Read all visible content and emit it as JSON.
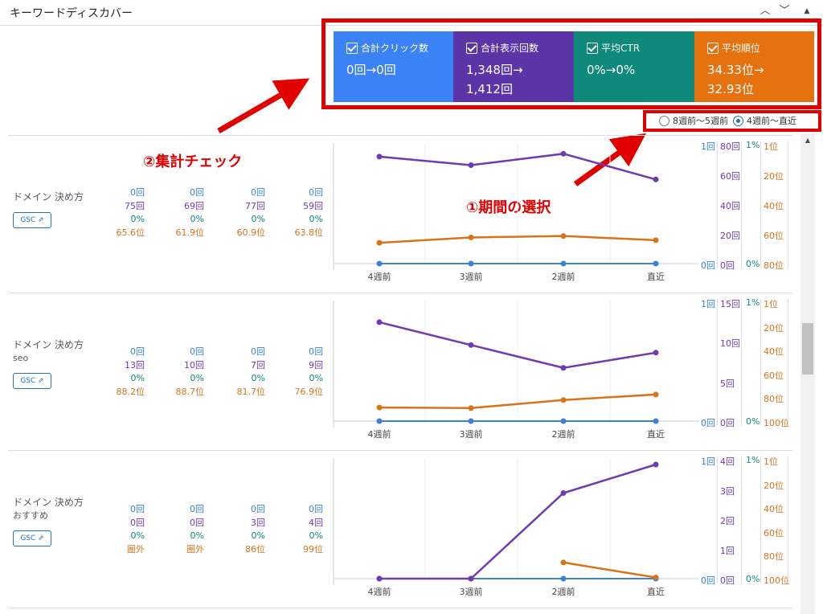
{
  "header": {
    "title": "キーワードディスカバー"
  },
  "metrics": [
    {
      "label": "合計クリック数",
      "value_line1": "0回→0回",
      "value_line2": "",
      "color": "#3b82f6"
    },
    {
      "label": "合計表示回数",
      "value_line1": "1,348回→",
      "value_line2": "1,412回",
      "color": "#5b35a8"
    },
    {
      "label": "平均CTR",
      "value_line1": "0%→0%",
      "value_line2": "",
      "color": "#0f8a7a"
    },
    {
      "label": "平均順位",
      "value_line1": "34.33位→",
      "value_line2": "32.93位",
      "color": "#e5720e"
    }
  ],
  "period": {
    "option1": "8週前〜5週前",
    "option2": "4週前〜直近",
    "selected": "option2"
  },
  "annotations": {
    "a1": "①期間の選択",
    "a2": "②集計チェック"
  },
  "gsc_label": "GSC",
  "x_labels": [
    "4週前",
    "3週前",
    "2週前",
    "直近"
  ],
  "rows": [
    {
      "keyword_line1": "ドメイン 決め方",
      "keyword_line2": "",
      "weeks": [
        {
          "clicks": "0回",
          "impressions": "75回",
          "ctr": "0%",
          "position": "65.6位"
        },
        {
          "clicks": "0回",
          "impressions": "69回",
          "ctr": "0%",
          "position": "61.9位"
        },
        {
          "clicks": "0回",
          "impressions": "77回",
          "ctr": "0%",
          "position": "60.9位"
        },
        {
          "clicks": "0回",
          "impressions": "59回",
          "ctr": "0%",
          "position": "63.8位"
        }
      ],
      "axis_clicks": [
        "1回",
        "0回"
      ],
      "axis_impr": [
        "80回",
        "60回",
        "40回",
        "20回",
        "0回"
      ],
      "axis_ctr": [
        "1%",
        "0%"
      ],
      "axis_pos": [
        "1位",
        "20位",
        "40位",
        "60位",
        "80位"
      ],
      "impr_values": [
        75,
        69,
        77,
        59
      ],
      "impr_max": 80,
      "pos_values": [
        65.6,
        61.9,
        60.9,
        63.8
      ],
      "pos_min": 1,
      "pos_max": 80
    },
    {
      "keyword_line1": "ドメイン 決め方",
      "keyword_line2": "seo",
      "weeks": [
        {
          "clicks": "0回",
          "impressions": "13回",
          "ctr": "0%",
          "position": "88.2位"
        },
        {
          "clicks": "0回",
          "impressions": "10回",
          "ctr": "0%",
          "position": "88.7位"
        },
        {
          "clicks": "0回",
          "impressions": "7回",
          "ctr": "0%",
          "position": "81.7位"
        },
        {
          "clicks": "0回",
          "impressions": "9回",
          "ctr": "0%",
          "position": "76.9位"
        }
      ],
      "axis_clicks": [
        "1回",
        "0回"
      ],
      "axis_impr": [
        "15回",
        "10回",
        "5回",
        "0回"
      ],
      "axis_ctr": [
        "1%",
        "0%"
      ],
      "axis_pos": [
        "1位",
        "20位",
        "40位",
        "60位",
        "80位",
        "100位"
      ],
      "impr_values": [
        13,
        10,
        7,
        9
      ],
      "impr_max": 15,
      "pos_values": [
        88.2,
        88.7,
        81.7,
        76.9
      ],
      "pos_min": 1,
      "pos_max": 100
    },
    {
      "keyword_line1": "ドメイン 決め方",
      "keyword_line2": "おすすめ",
      "weeks": [
        {
          "clicks": "0回",
          "impressions": "0回",
          "ctr": "0%",
          "position": "圏外"
        },
        {
          "clicks": "0回",
          "impressions": "0回",
          "ctr": "0%",
          "position": "圏外"
        },
        {
          "clicks": "0回",
          "impressions": "3回",
          "ctr": "0%",
          "position": "86位"
        },
        {
          "clicks": "0回",
          "impressions": "4回",
          "ctr": "0%",
          "position": "99位"
        }
      ],
      "axis_clicks": [
        "1回",
        "0回"
      ],
      "axis_impr": [
        "4回",
        "3回",
        "2回",
        "1回",
        "0回"
      ],
      "axis_ctr": [
        "1%",
        "0%"
      ],
      "axis_pos": [
        "1位",
        "20位",
        "40位",
        "60位",
        "80位",
        "100位"
      ],
      "impr_values": [
        0,
        0,
        3,
        4
      ],
      "impr_max": 4,
      "pos_values": [
        null,
        null,
        86,
        99
      ],
      "pos_min": 1,
      "pos_max": 100
    }
  ],
  "colors": {
    "clicks": "#3b82d6",
    "impressions": "#6f3bb3",
    "ctr": "#0f8a7a",
    "position": "#d9731a",
    "annotation": "#e00000"
  }
}
